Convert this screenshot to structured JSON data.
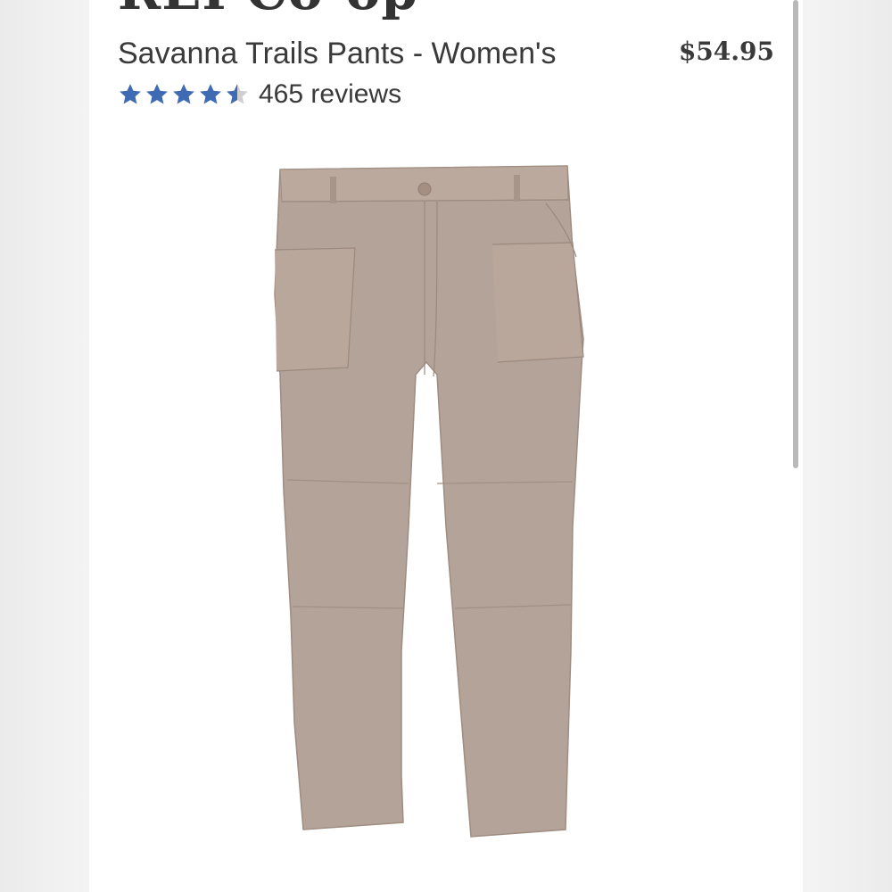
{
  "store": {
    "brand": "REI Co-op"
  },
  "product": {
    "title": "Savanna Trails Pants - Women's",
    "price": "$54.95",
    "rating": {
      "value": 4.5,
      "max": 5
    },
    "reviews_label": "465 reviews",
    "image_icon": "pants-image"
  },
  "colors": {
    "star": "#3f6bb5",
    "star_empty": "#cfcfcf",
    "fabric": "#b4a398"
  }
}
